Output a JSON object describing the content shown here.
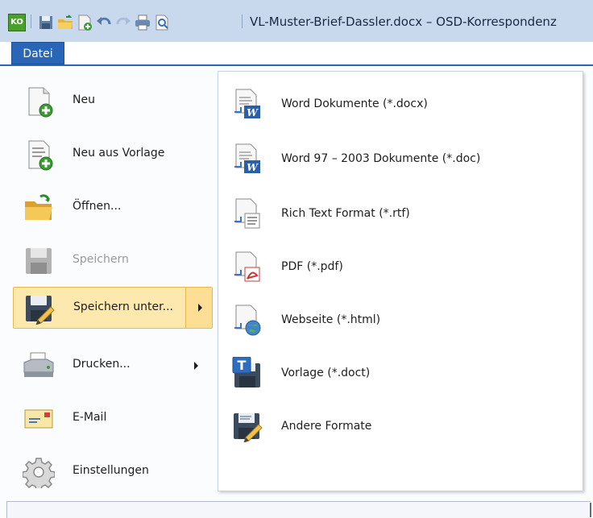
{
  "window": {
    "title": "VL-Muster-Brief-Dassler.docx – OSD-Korrespondenz",
    "app_logo": "KO"
  },
  "quick_access": [
    {
      "icon": "save-icon"
    },
    {
      "icon": "open-folder-icon"
    },
    {
      "icon": "new-document-icon"
    },
    {
      "icon": "undo-icon"
    },
    {
      "icon": "redo-icon"
    },
    {
      "icon": "print-icon"
    },
    {
      "icon": "print-preview-icon"
    }
  ],
  "ribbon": {
    "file_tab": "Datei"
  },
  "file_menu": {
    "items": [
      {
        "label": "Neu",
        "icon": "new-document-icon",
        "enabled": true,
        "has_submenu": false
      },
      {
        "label": "Neu aus Vorlage",
        "icon": "new-from-template-icon",
        "enabled": true,
        "has_submenu": false
      },
      {
        "label": "Öffnen...",
        "icon": "open-folder-icon",
        "enabled": true,
        "has_submenu": false
      },
      {
        "label": "Speichern",
        "icon": "save-icon",
        "enabled": false,
        "has_submenu": false
      },
      {
        "label": "Speichern unter...",
        "icon": "save-as-icon",
        "enabled": true,
        "has_submenu": true,
        "active": true
      },
      {
        "label": "Drucken...",
        "icon": "printer-icon",
        "enabled": true,
        "has_submenu": true
      },
      {
        "label": "E-Mail",
        "icon": "email-icon",
        "enabled": true,
        "has_submenu": false
      },
      {
        "label": "Einstellungen",
        "icon": "settings-gear-icon",
        "enabled": true,
        "has_submenu": false
      }
    ]
  },
  "save_as_submenu": {
    "items": [
      {
        "label": "Word Dokumente (*.docx)",
        "icon": "word-docx-icon"
      },
      {
        "label": "Word 97 – 2003 Dokumente (*.doc)",
        "icon": "word-doc-icon"
      },
      {
        "label": "Rich Text Format (*.rtf)",
        "icon": "rtf-document-icon"
      },
      {
        "label": "PDF (*.pdf)",
        "icon": "pdf-document-icon"
      },
      {
        "label": "Webseite (*.html)",
        "icon": "webpage-globe-icon"
      },
      {
        "label": "Vorlage (*.doct)",
        "icon": "template-icon"
      },
      {
        "label": "Andere Formate",
        "icon": "other-formats-save-icon"
      }
    ]
  },
  "colors": {
    "titlebar": "#c8d9ee",
    "file_tab": "#2a66b8",
    "highlight": "#fde9ad",
    "highlight_border": "#e5b94e"
  }
}
